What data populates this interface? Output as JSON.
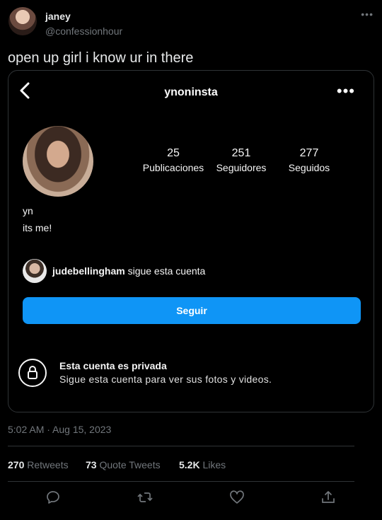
{
  "tweet": {
    "author_name": "janey",
    "author_handle": "@confessionhour",
    "more_label": "•••",
    "text": "open up girl i know ur in there",
    "timestamp": "5:02 AM · Aug 15, 2023"
  },
  "embedded_profile": {
    "username": "ynoninsta",
    "more_label": "•••",
    "stats": [
      {
        "value": "25",
        "label": "Publicaciones"
      },
      {
        "value": "251",
        "label": "Seguidores"
      },
      {
        "value": "277",
        "label": "Seguidos"
      }
    ],
    "bio_name": "yn",
    "bio_text": "its me!",
    "followed_by_user": "judebellingham",
    "followed_by_suffix": " sigue esta cuenta",
    "follow_button_label": "Seguir",
    "private_title": "Esta cuenta es privada",
    "private_subtitle": "Sigue esta cuenta para ver sus fotos y videos.",
    "accent_color": "#0f95f6"
  },
  "metrics": {
    "retweets_count": "270",
    "retweets_label": " Retweets",
    "quotes_count": "73",
    "quotes_label": " Quote Tweets",
    "likes_count": "5.2K",
    "likes_label": " Likes"
  },
  "actions": [
    "reply-icon",
    "retweet-icon",
    "like-icon",
    "share-icon"
  ]
}
